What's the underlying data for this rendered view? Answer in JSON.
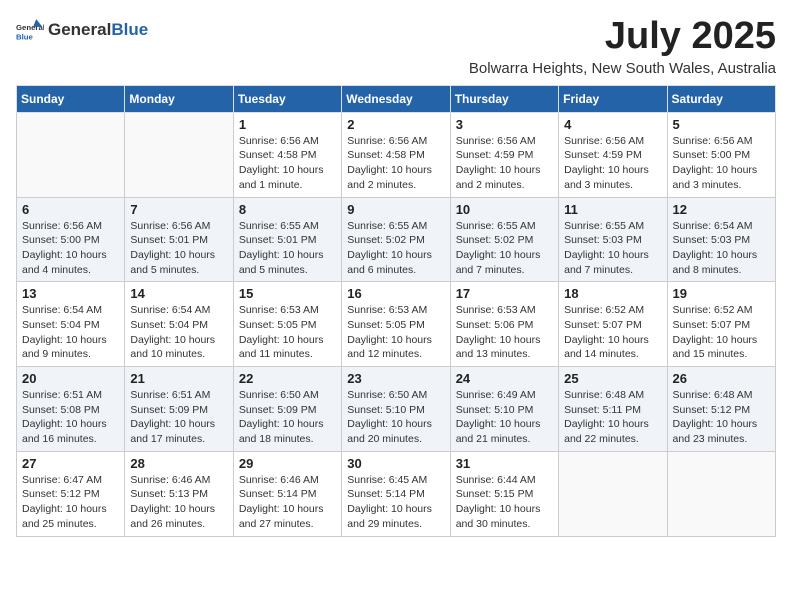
{
  "logo": {
    "general": "General",
    "blue": "Blue"
  },
  "header": {
    "month_year": "July 2025",
    "location": "Bolwarra Heights, New South Wales, Australia"
  },
  "days_of_week": [
    "Sunday",
    "Monday",
    "Tuesday",
    "Wednesday",
    "Thursday",
    "Friday",
    "Saturday"
  ],
  "weeks": [
    [
      {
        "day": "",
        "info": ""
      },
      {
        "day": "",
        "info": ""
      },
      {
        "day": "1",
        "info": "Sunrise: 6:56 AM\nSunset: 4:58 PM\nDaylight: 10 hours and 1 minute."
      },
      {
        "day": "2",
        "info": "Sunrise: 6:56 AM\nSunset: 4:58 PM\nDaylight: 10 hours and 2 minutes."
      },
      {
        "day": "3",
        "info": "Sunrise: 6:56 AM\nSunset: 4:59 PM\nDaylight: 10 hours and 2 minutes."
      },
      {
        "day": "4",
        "info": "Sunrise: 6:56 AM\nSunset: 4:59 PM\nDaylight: 10 hours and 3 minutes."
      },
      {
        "day": "5",
        "info": "Sunrise: 6:56 AM\nSunset: 5:00 PM\nDaylight: 10 hours and 3 minutes."
      }
    ],
    [
      {
        "day": "6",
        "info": "Sunrise: 6:56 AM\nSunset: 5:00 PM\nDaylight: 10 hours and 4 minutes."
      },
      {
        "day": "7",
        "info": "Sunrise: 6:56 AM\nSunset: 5:01 PM\nDaylight: 10 hours and 5 minutes."
      },
      {
        "day": "8",
        "info": "Sunrise: 6:55 AM\nSunset: 5:01 PM\nDaylight: 10 hours and 5 minutes."
      },
      {
        "day": "9",
        "info": "Sunrise: 6:55 AM\nSunset: 5:02 PM\nDaylight: 10 hours and 6 minutes."
      },
      {
        "day": "10",
        "info": "Sunrise: 6:55 AM\nSunset: 5:02 PM\nDaylight: 10 hours and 7 minutes."
      },
      {
        "day": "11",
        "info": "Sunrise: 6:55 AM\nSunset: 5:03 PM\nDaylight: 10 hours and 7 minutes."
      },
      {
        "day": "12",
        "info": "Sunrise: 6:54 AM\nSunset: 5:03 PM\nDaylight: 10 hours and 8 minutes."
      }
    ],
    [
      {
        "day": "13",
        "info": "Sunrise: 6:54 AM\nSunset: 5:04 PM\nDaylight: 10 hours and 9 minutes."
      },
      {
        "day": "14",
        "info": "Sunrise: 6:54 AM\nSunset: 5:04 PM\nDaylight: 10 hours and 10 minutes."
      },
      {
        "day": "15",
        "info": "Sunrise: 6:53 AM\nSunset: 5:05 PM\nDaylight: 10 hours and 11 minutes."
      },
      {
        "day": "16",
        "info": "Sunrise: 6:53 AM\nSunset: 5:05 PM\nDaylight: 10 hours and 12 minutes."
      },
      {
        "day": "17",
        "info": "Sunrise: 6:53 AM\nSunset: 5:06 PM\nDaylight: 10 hours and 13 minutes."
      },
      {
        "day": "18",
        "info": "Sunrise: 6:52 AM\nSunset: 5:07 PM\nDaylight: 10 hours and 14 minutes."
      },
      {
        "day": "19",
        "info": "Sunrise: 6:52 AM\nSunset: 5:07 PM\nDaylight: 10 hours and 15 minutes."
      }
    ],
    [
      {
        "day": "20",
        "info": "Sunrise: 6:51 AM\nSunset: 5:08 PM\nDaylight: 10 hours and 16 minutes."
      },
      {
        "day": "21",
        "info": "Sunrise: 6:51 AM\nSunset: 5:09 PM\nDaylight: 10 hours and 17 minutes."
      },
      {
        "day": "22",
        "info": "Sunrise: 6:50 AM\nSunset: 5:09 PM\nDaylight: 10 hours and 18 minutes."
      },
      {
        "day": "23",
        "info": "Sunrise: 6:50 AM\nSunset: 5:10 PM\nDaylight: 10 hours and 20 minutes."
      },
      {
        "day": "24",
        "info": "Sunrise: 6:49 AM\nSunset: 5:10 PM\nDaylight: 10 hours and 21 minutes."
      },
      {
        "day": "25",
        "info": "Sunrise: 6:48 AM\nSunset: 5:11 PM\nDaylight: 10 hours and 22 minutes."
      },
      {
        "day": "26",
        "info": "Sunrise: 6:48 AM\nSunset: 5:12 PM\nDaylight: 10 hours and 23 minutes."
      }
    ],
    [
      {
        "day": "27",
        "info": "Sunrise: 6:47 AM\nSunset: 5:12 PM\nDaylight: 10 hours and 25 minutes."
      },
      {
        "day": "28",
        "info": "Sunrise: 6:46 AM\nSunset: 5:13 PM\nDaylight: 10 hours and 26 minutes."
      },
      {
        "day": "29",
        "info": "Sunrise: 6:46 AM\nSunset: 5:14 PM\nDaylight: 10 hours and 27 minutes."
      },
      {
        "day": "30",
        "info": "Sunrise: 6:45 AM\nSunset: 5:14 PM\nDaylight: 10 hours and 29 minutes."
      },
      {
        "day": "31",
        "info": "Sunrise: 6:44 AM\nSunset: 5:15 PM\nDaylight: 10 hours and 30 minutes."
      },
      {
        "day": "",
        "info": ""
      },
      {
        "day": "",
        "info": ""
      }
    ]
  ]
}
